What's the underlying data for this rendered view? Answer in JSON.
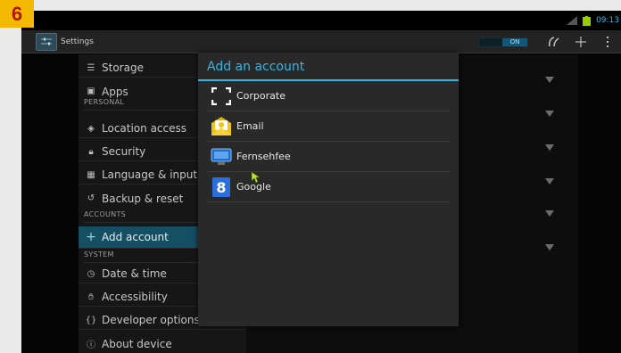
{
  "badge": "6",
  "status": {
    "clock": "09:13"
  },
  "actionbar": {
    "title": "Settings",
    "toggle_label": "ON"
  },
  "menu": {
    "items": [
      {
        "key": "storage",
        "label": "Storage",
        "icon": "storage-icon"
      },
      {
        "key": "apps",
        "label": "Apps",
        "icon": "apps-icon"
      }
    ],
    "personal_header": "PERSONAL",
    "personal": [
      {
        "key": "location-access",
        "label": "Location access",
        "icon": "location-icon"
      },
      {
        "key": "security",
        "label": "Security",
        "icon": "lock-icon"
      },
      {
        "key": "language-input",
        "label": "Language & input",
        "icon": "keyboard-icon"
      },
      {
        "key": "backup-reset",
        "label": "Backup & reset",
        "icon": "backup-icon"
      }
    ],
    "accounts_header": "ACCOUNTS",
    "accounts": [
      {
        "key": "add-account",
        "label": "Add account",
        "icon": "plus-icon"
      }
    ],
    "system_header": "SYSTEM",
    "system": [
      {
        "key": "date-time",
        "label": "Date & time",
        "icon": "clock-icon"
      },
      {
        "key": "accessibility",
        "label": "Accessibility",
        "icon": "hand-icon"
      },
      {
        "key": "developer-options",
        "label": "Developer options",
        "icon": "braces-icon"
      },
      {
        "key": "about-device",
        "label": "About device",
        "icon": "info-icon"
      }
    ]
  },
  "dialog": {
    "title": "Add an account",
    "accounts": [
      {
        "label": "Corporate",
        "icon": "corporate-icon"
      },
      {
        "label": "Email",
        "icon": "email-icon"
      },
      {
        "label": "Fernsehfee",
        "icon": "fernsehfee-icon"
      },
      {
        "label": "Google",
        "icon": "google-icon"
      }
    ]
  },
  "colors": {
    "accent": "#33b5e5",
    "selected": "#144f63",
    "badge": "#f2b900",
    "badge_text": "#b31400"
  }
}
